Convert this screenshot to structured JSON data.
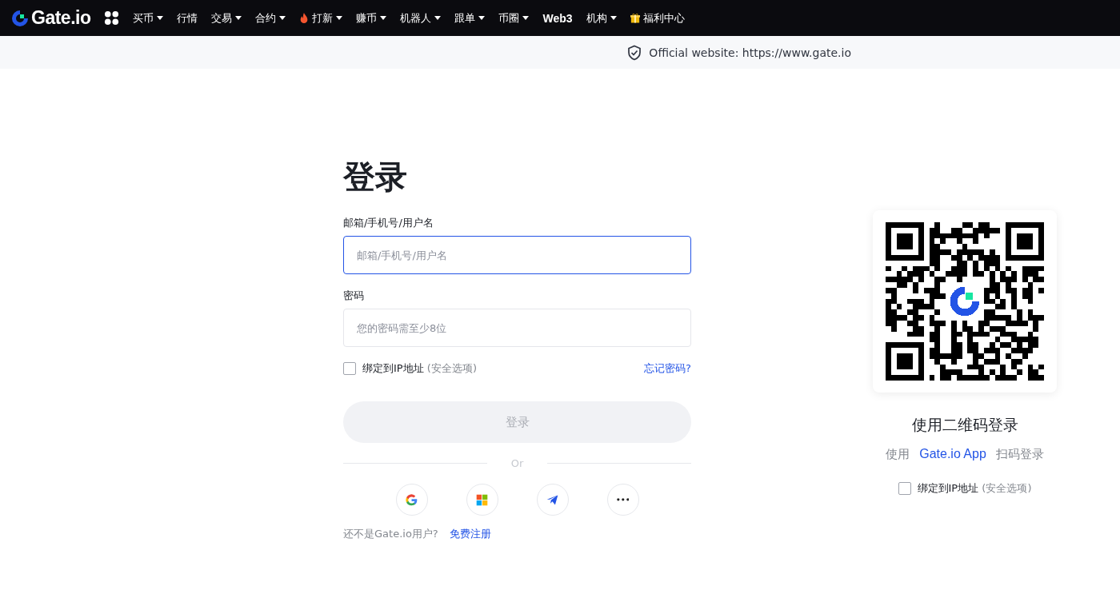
{
  "nav": {
    "logo": "Gate.io",
    "items": [
      {
        "label": "买币",
        "kind": "plain",
        "has_caret": true
      },
      {
        "label": "行情",
        "kind": "plain",
        "has_caret": false
      },
      {
        "label": "交易",
        "kind": "plain",
        "has_caret": true
      },
      {
        "label": "合约",
        "kind": "plain",
        "has_caret": true
      },
      {
        "label": "打新",
        "kind": "hot",
        "has_caret": true
      },
      {
        "label": "赚币",
        "kind": "plain",
        "has_caret": true
      },
      {
        "label": "机器人",
        "kind": "plain",
        "has_caret": true
      },
      {
        "label": "跟单",
        "kind": "plain",
        "has_caret": true
      },
      {
        "label": "币圈",
        "kind": "plain",
        "has_caret": true
      },
      {
        "label": "Web3",
        "kind": "bold",
        "has_caret": false
      },
      {
        "label": "机构",
        "kind": "plain",
        "has_caret": true
      },
      {
        "label": "福利中心",
        "kind": "reward",
        "has_caret": false
      }
    ]
  },
  "notice": "Official website: https://www.gate.io",
  "login": {
    "title": "登录",
    "fields": [
      {
        "label": "邮箱/手机号/用户名",
        "placeholder": "邮箱/手机号/用户名",
        "focused": true
      },
      {
        "label": "密码",
        "placeholder": "您的密码需至少8位",
        "focused": false
      }
    ],
    "bind_ip": {
      "label": "绑定到IP地址",
      "note": "(安全选项)",
      "checked": false
    },
    "forgot": "忘记密码?",
    "submit": {
      "label": "登录",
      "disabled": true
    },
    "divider": "Or",
    "social": [
      {
        "kind": "google"
      },
      {
        "kind": "microsoft"
      },
      {
        "kind": "telegram"
      },
      {
        "kind": "more"
      }
    ],
    "signup_prompt": "还不是Gate.io用户?",
    "signup_link": "免费注册"
  },
  "qr": {
    "title": "使用二维码登录",
    "hint_before": "使用",
    "hint_app": "Gate.io App",
    "hint_after": "扫码登录",
    "bind_ip": {
      "label": "绑定到IP地址",
      "note": "(安全选项)",
      "checked": false
    }
  }
}
